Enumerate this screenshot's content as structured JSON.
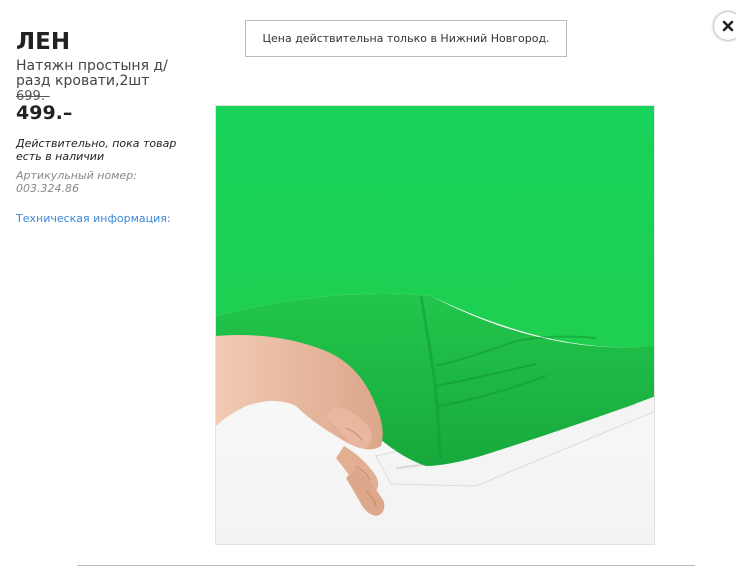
{
  "product": {
    "name": "ЛЕН",
    "description": "Натяжн простыня д/разд кровати,2шт",
    "old_price": "699.-",
    "price": "499.–",
    "availability": "Действительно, пока товар есть в наличии",
    "article": "Артикульный номер: 003.324.86",
    "tech_info_link": "Техническая информация:"
  },
  "notice": {
    "text": "Цена действительна только в Нижний Новгород."
  },
  "controls": {
    "close_icon": "close-icon"
  },
  "image": {
    "subject": "green fitted sheet on mattress",
    "colors": {
      "sheet": "#1fc94f",
      "sheet_dark": "#15a83c",
      "mattress": "#f2f2f2",
      "skin": "#e9b9a0"
    }
  }
}
